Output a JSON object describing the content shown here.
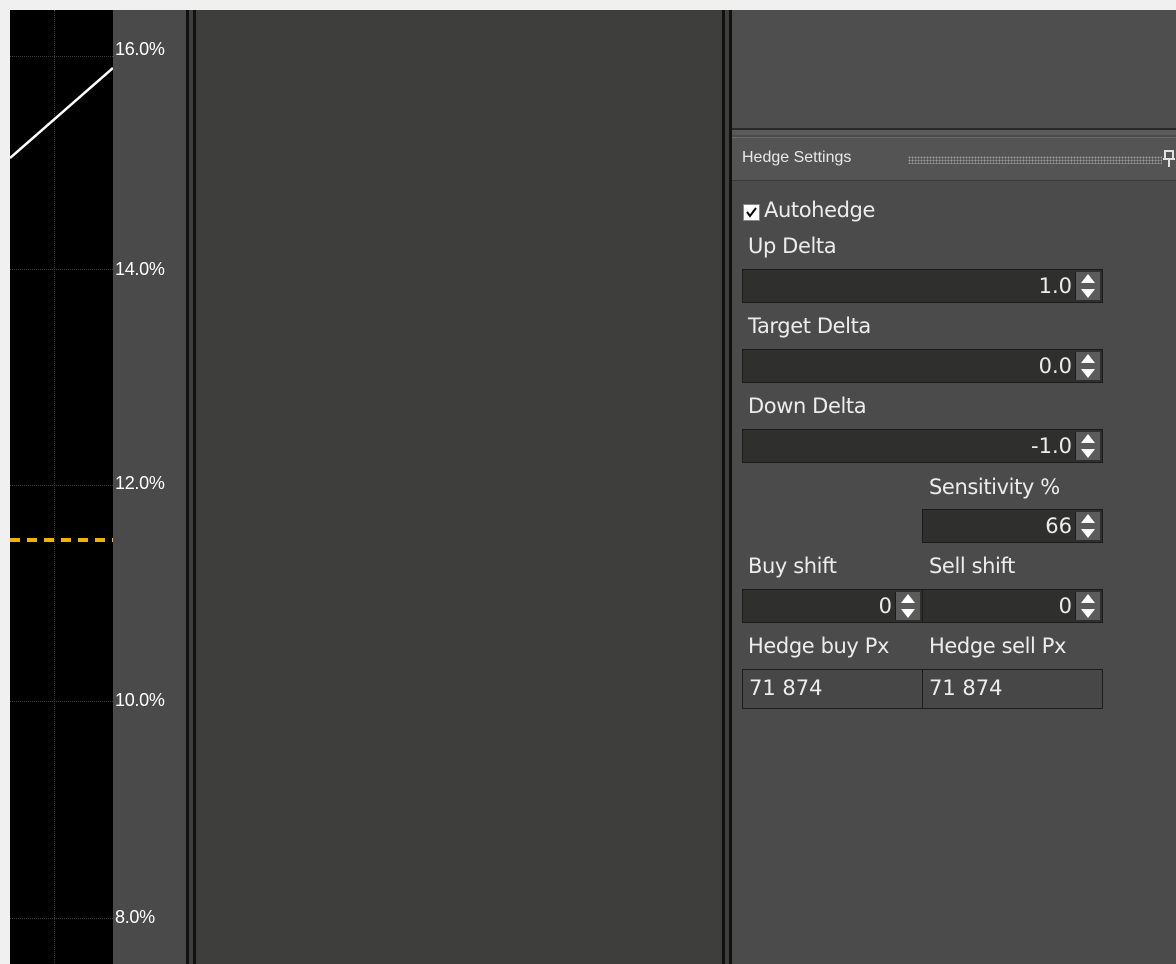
{
  "chart": {
    "y_ticks": [
      "16.0%",
      "14.0%",
      "12.0%",
      "10.0%",
      "8.0%"
    ],
    "line_color": "#ffffff",
    "dashed_line_color": "#f2b300",
    "dashed_line_y": "11.5%"
  },
  "hedge_settings": {
    "title": "Hedge Settings",
    "autohedge": {
      "label": "Autohedge",
      "checked": true
    },
    "up_delta": {
      "label": "Up Delta",
      "value": "1.0"
    },
    "target_delta": {
      "label": "Target Delta",
      "value": "0.0"
    },
    "down_delta": {
      "label": "Down Delta",
      "value": "-1.0"
    },
    "sensitivity": {
      "label": "Sensitivity %",
      "value": "66"
    },
    "buy_shift": {
      "label": "Buy shift",
      "value": "0"
    },
    "sell_shift": {
      "label": "Sell shift",
      "value": "0"
    },
    "hedge_buy_px": {
      "label": "Hedge buy Px",
      "value": "71 874"
    },
    "hedge_sell_px": {
      "label": "Hedge sell Px",
      "value": "71 874"
    }
  }
}
